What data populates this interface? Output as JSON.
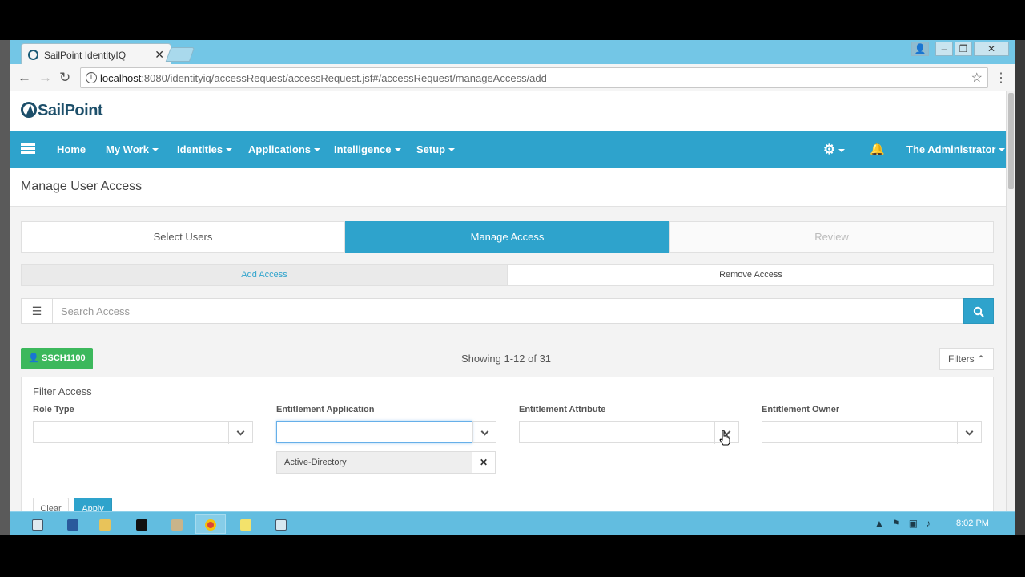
{
  "browser": {
    "tab_title": "SailPoint IdentityIQ",
    "url_host": "localhost",
    "url_path": ":8080/identityiq/accessRequest/accessRequest.jsf#/accessRequest/manageAccess/add"
  },
  "app": {
    "logo": "SailPoint",
    "nav": {
      "home": "Home",
      "my_work": "My Work",
      "identities": "Identities",
      "applications": "Applications",
      "intelligence": "Intelligence",
      "setup": "Setup",
      "user": "The Administrator"
    },
    "page_title": "Manage User Access",
    "steps": {
      "select_users": "Select Users",
      "manage_access": "Manage Access",
      "review": "Review"
    },
    "subtabs": {
      "add": "Add Access",
      "remove": "Remove Access"
    },
    "search": {
      "placeholder": "Search Access"
    },
    "results": {
      "user_badge": "SSCH1100",
      "showing": "Showing 1-12 of 31",
      "filters": "Filters"
    },
    "filter_panel": {
      "title": "Filter Access",
      "role_type": "Role Type",
      "entitlement_application": "Entitlement Application",
      "entitlement_attribute": "Entitlement Attribute",
      "entitlement_owner": "Entitlement Owner",
      "selected_application": "Active-Directory",
      "clear": "Clear",
      "apply": "Apply"
    }
  },
  "taskbar": {
    "clock": "8:02 PM"
  },
  "colors": {
    "primary": "#2ea3cc",
    "success": "#3cb85c",
    "window_chrome": "#73c6e6"
  }
}
